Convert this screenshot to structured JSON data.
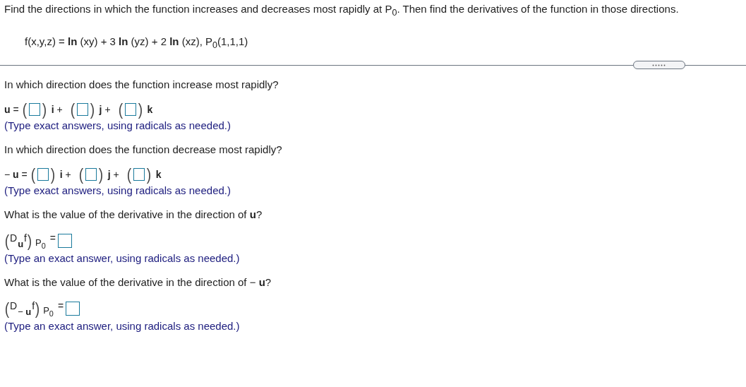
{
  "problem": {
    "statement": "Find the directions in which the function increases and decreases most rapidly at P$_{0}$. Then find the derivatives of the function in those directions.",
    "formula": "f(x,y,z) = **ln** (xy) + 3 **ln** (yz) + 2 **ln** (xz),   P$_{0}$(1,1,1)"
  },
  "parts": [
    {
      "kind": "vector",
      "question": "In which direction does the function increase most rapidly?",
      "lhs": "**u** =",
      "components": [
        {
          "open": "(",
          "close": ")",
          "label": "**i** +"
        },
        {
          "open": "(",
          "close": ")",
          "label": "**j** +"
        },
        {
          "open": "(",
          "close": ")",
          "label": "**k**"
        }
      ],
      "hint": "(Type exact answers, using radicals as needed.)"
    },
    {
      "kind": "vector",
      "question": "In which direction does the function decrease most rapidly?",
      "lhs": "− **u** =",
      "components": [
        {
          "open": "(",
          "close": ")",
          "label": "**i** +"
        },
        {
          "open": "(",
          "close": ")",
          "label": "**j** +"
        },
        {
          "open": "(",
          "close": ")",
          "label": "**k**"
        }
      ],
      "hint": "(Type exact answers, using radicals as needed.)"
    },
    {
      "kind": "derivative",
      "question": "What is the value of the derivative in the direction of **u**?",
      "open": "(",
      "operator": "D",
      "direction": "**u**",
      "function": "f",
      "close": ")",
      "point": "P$_{0}$",
      "equals": "=",
      "hint": "(Type an exact answer, using radicals as needed.)"
    },
    {
      "kind": "derivative",
      "question": "What is the value of the derivative in the direction of  − **u**?",
      "open": "(",
      "operator": "D",
      "direction": "− **u**",
      "function": "f",
      "close": ")",
      "point": "P$_{0}$",
      "equals": "=",
      "hint": "(Type an exact answer, using radicals as needed.)"
    }
  ]
}
